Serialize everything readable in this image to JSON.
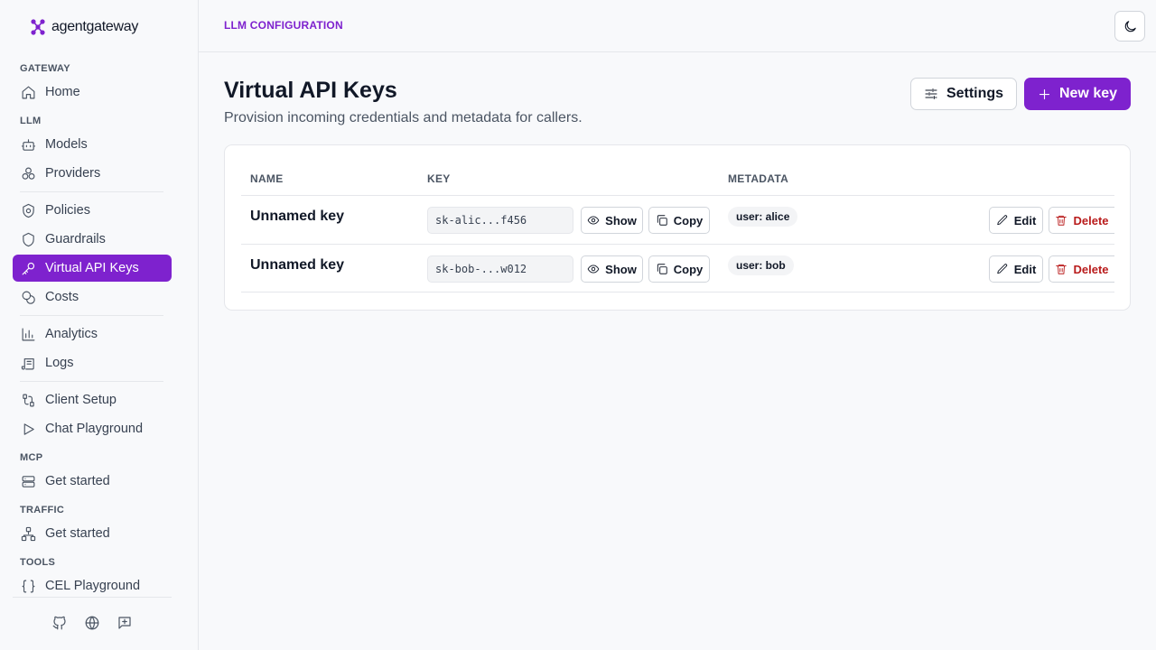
{
  "brand": {
    "name": "agentgateway",
    "color": "#7e22ce"
  },
  "sidebar": {
    "sections": {
      "gateway": "GATEWAY",
      "llm": "LLM",
      "mcp": "MCP",
      "traffic": "TRAFFIC",
      "tools": "TOOLS"
    },
    "items": {
      "home": "Home",
      "models": "Models",
      "providers": "Providers",
      "policies": "Policies",
      "guardrails": "Guardrails",
      "virtual_keys": "Virtual API Keys",
      "costs": "Costs",
      "analytics": "Analytics",
      "logs": "Logs",
      "client_setup": "Client Setup",
      "chat_playground": "Chat Playground",
      "mcp_get_started": "Get started",
      "traffic_get_started": "Get started",
      "cel_playground": "CEL Playground"
    },
    "active_item": "virtual_keys",
    "footer_icons": [
      "github-icon",
      "globe-icon",
      "feedback-icon"
    ]
  },
  "header": {
    "breadcrumb": "LLM CONFIGURATION",
    "theme_icon": "moon-icon"
  },
  "main": {
    "title": "Virtual API Keys",
    "subtitle": "Provision incoming credentials and metadata for callers.",
    "settings_label": "Settings",
    "new_key_label": "New key"
  },
  "table": {
    "columns": {
      "name": "NAME",
      "key": "KEY",
      "metadata": "METADATA"
    },
    "rows": [
      {
        "name": "Unnamed key",
        "key": "sk-alic...f456",
        "metadata": "user: alice",
        "show": "Show",
        "copy": "Copy",
        "edit": "Edit",
        "delete": "Delete"
      },
      {
        "name": "Unnamed key",
        "key": "sk-bob-...w012",
        "metadata": "user: bob",
        "show": "Show",
        "copy": "Copy",
        "edit": "Edit",
        "delete": "Delete"
      }
    ]
  },
  "colors": {
    "accent": "#7e22ce",
    "danger": "#b91c1c"
  }
}
